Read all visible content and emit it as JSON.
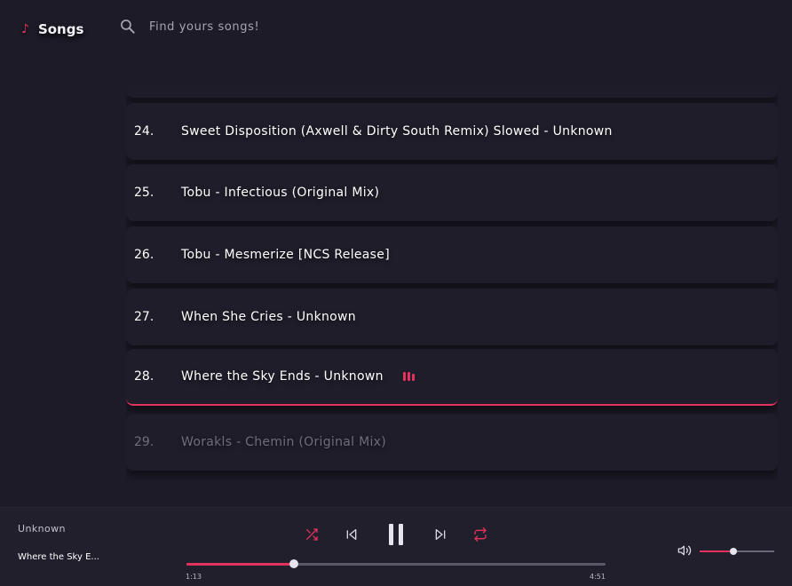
{
  "header": {
    "brand_icon": "music-note-icon",
    "brand_title": "Songs",
    "search_icon": "search-icon",
    "search_placeholder": "Find yours songs!"
  },
  "tracks": [
    {
      "number": "24.",
      "title": "Sweet Disposition (Axwell & Dirty South Remix) Slowed - Unknown"
    },
    {
      "number": "25.",
      "title": "Tobu - Infectious (Original Mix)"
    },
    {
      "number": "26.",
      "title": "Tobu - Mesmerize [NCS Release]"
    },
    {
      "number": "27.",
      "title": "When She Cries - Unknown"
    },
    {
      "number": "28.",
      "title": "Where the Sky Ends - Unknown",
      "playing": true
    },
    {
      "number": "29.",
      "title": "Worakls - Chemin (Original Mix)"
    }
  ],
  "player": {
    "artist": "Unknown",
    "title": "Where the Sky E...",
    "current_time": "1:13",
    "total_time": "4:51",
    "progress": 0.256,
    "volume": 0.45,
    "controls": [
      "shuffle-icon",
      "previous-icon",
      "pause-icon",
      "next-icon",
      "repeat-icon"
    ]
  },
  "colors": {
    "accent": "#e2325d",
    "background": "#1c1b27",
    "player_background": "#211f2c"
  }
}
